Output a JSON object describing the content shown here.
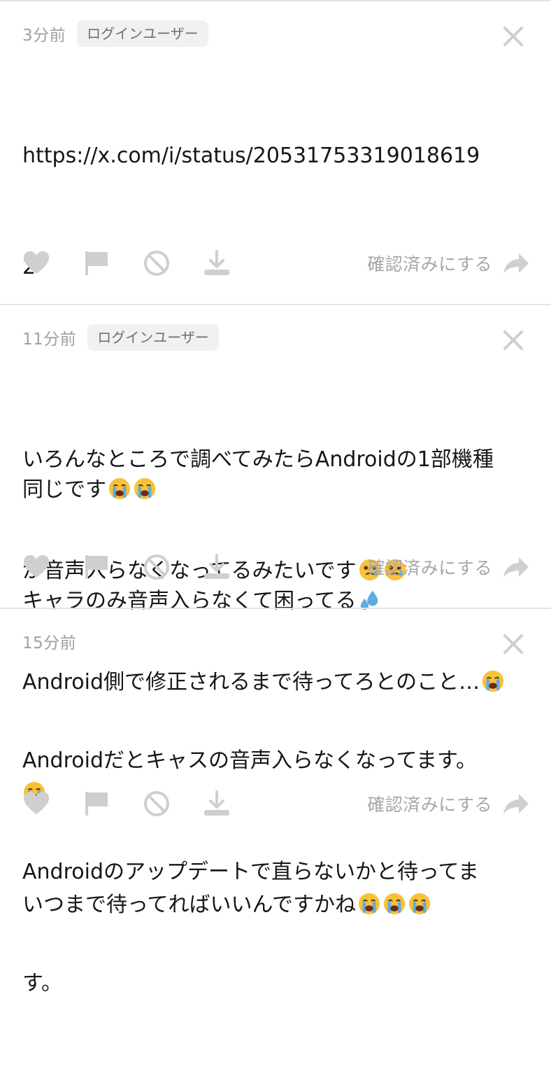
{
  "colors": {
    "icon_gray": "#cfcfcf",
    "text_gray": "#a6a6a6",
    "badge_bg": "#f1f1f1",
    "divider": "#e3e3e3"
  },
  "confirm_label": "確認済みにする",
  "comments": [
    {
      "time": "3分前",
      "badge": "ログインユーザー",
      "lines": [
        "https://x.com/i/status/20531753319018619",
        "2",
        "",
        "同じです",
        "キャラのみ音声入らなくて困ってる"
      ]
    },
    {
      "time": "11分前",
      "badge": "ログインユーザー",
      "lines": [
        "いろんなところで調べてみたらAndroidの1部機種",
        "が音声入らなくなってるみたいです",
        "Android側で修正されるまで待ってろとのこと…",
        "",
        "いつまで待ってればいいんですかね"
      ]
    },
    {
      "time": "15分前",
      "lines": [
        "Androidだとキャスの音声入らなくなってます。",
        "Androidのアップデートで直らないかと待ってま",
        "す。"
      ]
    }
  ]
}
